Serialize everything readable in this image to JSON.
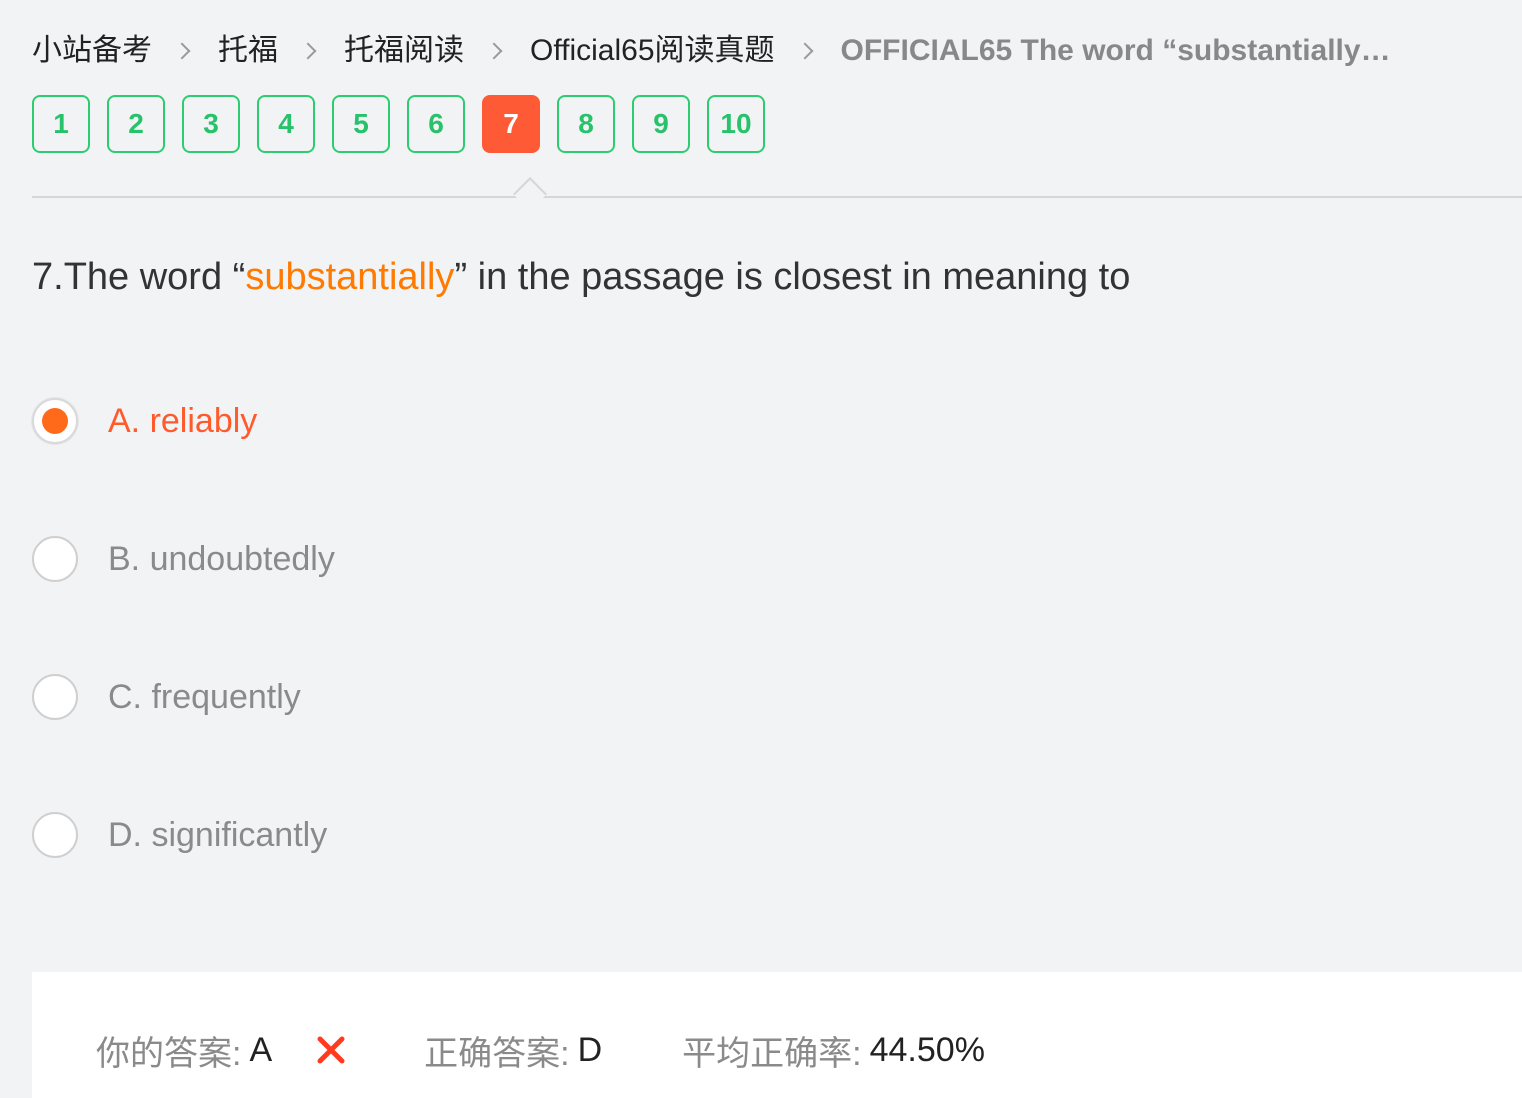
{
  "breadcrumb": {
    "items": [
      "小站备考",
      "托福",
      "托福阅读",
      "Official65阅读真题"
    ],
    "current": "OFFICIAL65 The word “substantially”…"
  },
  "question_nav": {
    "buttons": [
      "1",
      "2",
      "3",
      "4",
      "5",
      "6",
      "7",
      "8",
      "9",
      "10"
    ],
    "active": "7"
  },
  "question": {
    "prefix": "7.The word “",
    "highlight": "substantially",
    "suffix": "” in the passage is closest in meaning to"
  },
  "options": [
    {
      "label": "A. reliably",
      "selected": true
    },
    {
      "label": "B. undoubtedly",
      "selected": false
    },
    {
      "label": "C. frequently",
      "selected": false
    },
    {
      "label": "D. significantly",
      "selected": false
    }
  ],
  "answer": {
    "yours_label": "你的答案:",
    "yours_value": "A",
    "correct_label": "正确答案:",
    "correct_value": "D",
    "avg_label": "平均正确率:",
    "avg_value": "44.50%"
  },
  "colors": {
    "accent_green": "#2ecc71",
    "active_red": "#ff5a36",
    "highlight_orange": "#ff7a00",
    "wrong_red": "#ff3b1f"
  },
  "icons": {
    "breadcrumb_separator": "chevron-right-icon",
    "wrong": "close-icon"
  }
}
